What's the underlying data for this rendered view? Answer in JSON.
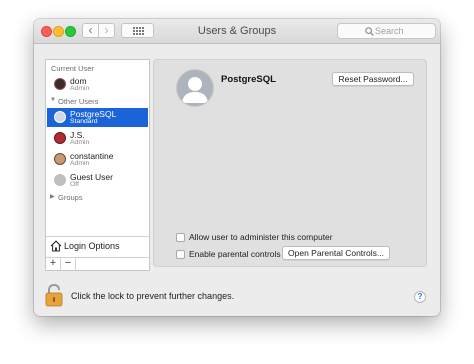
{
  "window": {
    "title": "Users & Groups"
  },
  "toolbar": {
    "back_glyph": "‹",
    "forward_glyph": "›",
    "grid_icon": "grid-icon",
    "search_placeholder": "Search"
  },
  "sidebar": {
    "current_user_label": "Current User",
    "current_user": {
      "name": "dom",
      "role": "Admin"
    },
    "other_users_label": "Other Users",
    "other_users": [
      {
        "name": "PostgreSQL",
        "role": "Standard",
        "selected": true
      },
      {
        "name": "J.S.",
        "role": "Admin"
      },
      {
        "name": "constantine",
        "role": "Admin"
      },
      {
        "name": "Guest User",
        "role": "Off"
      }
    ],
    "groups_label": "Groups",
    "login_options_label": "Login Options",
    "add_glyph": "+",
    "remove_glyph": "−"
  },
  "detail": {
    "user_name": "PostgreSQL",
    "reset_password_label": "Reset Password...",
    "allow_admin_label": "Allow user to administer this computer",
    "allow_admin_checked": false,
    "parental_controls_label": "Enable parental controls",
    "parental_controls_checked": false,
    "open_parental_controls_label": "Open Parental Controls..."
  },
  "footer": {
    "lock_text": "Click the lock to prevent further changes.",
    "help_glyph": "?"
  },
  "colors": {
    "selection": "#1b63d8",
    "close": "#ff5f57",
    "minimize": "#febc2e",
    "zoom": "#28c840",
    "lock": "#e6a23c"
  }
}
